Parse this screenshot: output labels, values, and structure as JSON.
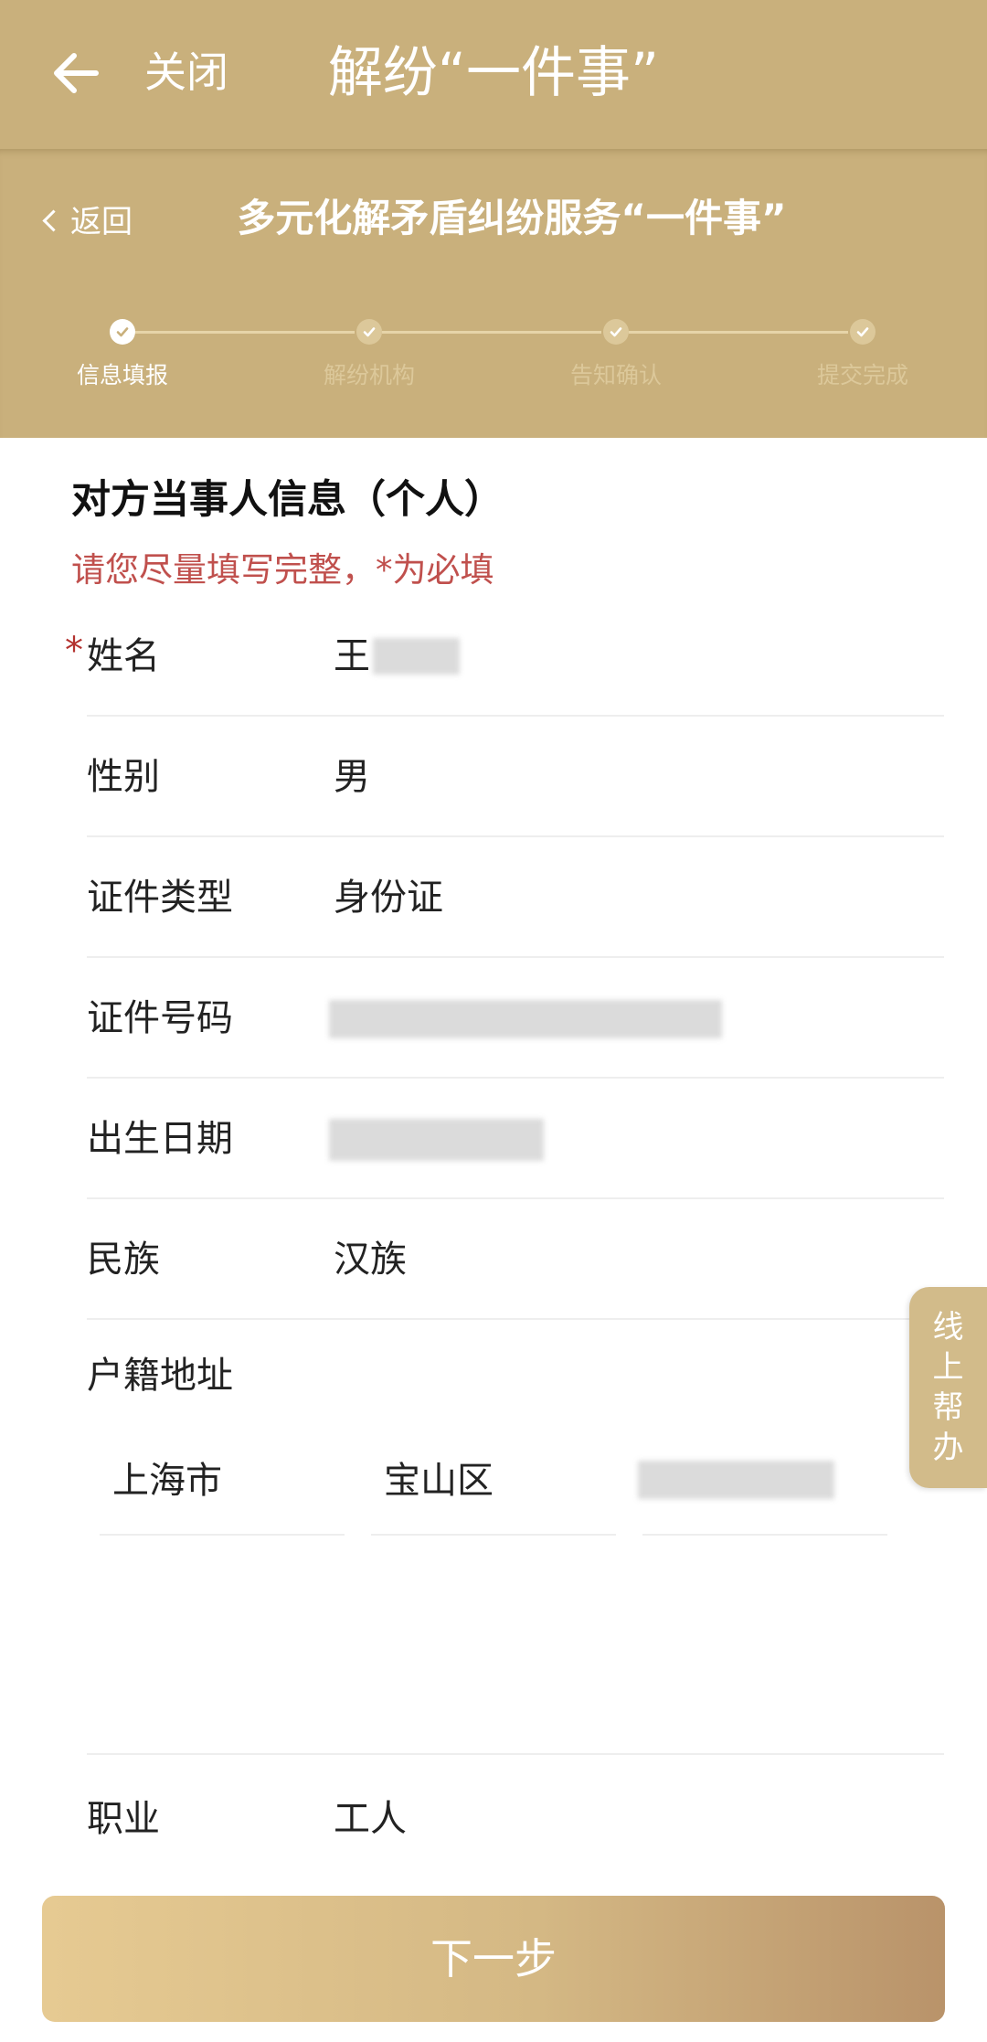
{
  "topbar": {
    "close_label": "关闭",
    "title": "解纷“一件事”",
    "back_icon": "arrow-left-icon"
  },
  "subheader": {
    "return_label": "返回",
    "page_title": "多元化解矛盾纠纷服务“一件事”"
  },
  "stepper": {
    "steps": [
      {
        "label": "信息填报",
        "state": "done"
      },
      {
        "label": "解纷机构",
        "state": "pending"
      },
      {
        "label": "告知确认",
        "state": "pending"
      },
      {
        "label": "提交完成",
        "state": "pending"
      }
    ]
  },
  "form": {
    "section_title": "对方当事人信息（个人）",
    "hint": "请您尽量填写完整，*为必填",
    "required_mark": "*",
    "rows": [
      {
        "label": "姓名",
        "value": "王",
        "required": true
      },
      {
        "label": "性别",
        "value": "男"
      },
      {
        "label": "证件类型",
        "value": "身份证"
      },
      {
        "label": "证件号码",
        "value": ""
      },
      {
        "label": "出生日期",
        "value": ""
      },
      {
        "label": "民族",
        "value": "汉族"
      }
    ],
    "address": {
      "label": "户籍地址",
      "city": "上海市",
      "district": "宝山区",
      "detail": ""
    },
    "occupation": {
      "label": "职业",
      "value": "工人"
    }
  },
  "side_help": {
    "chars": [
      "线",
      "上",
      "帮",
      "办"
    ]
  },
  "next_button": {
    "label": "下一步"
  },
  "colors": {
    "header_bg": "#c9b07c",
    "hint_red": "#c0504d",
    "required_red": "#b3322f",
    "button_start": "#e6ca92",
    "button_end": "#b9936a"
  }
}
